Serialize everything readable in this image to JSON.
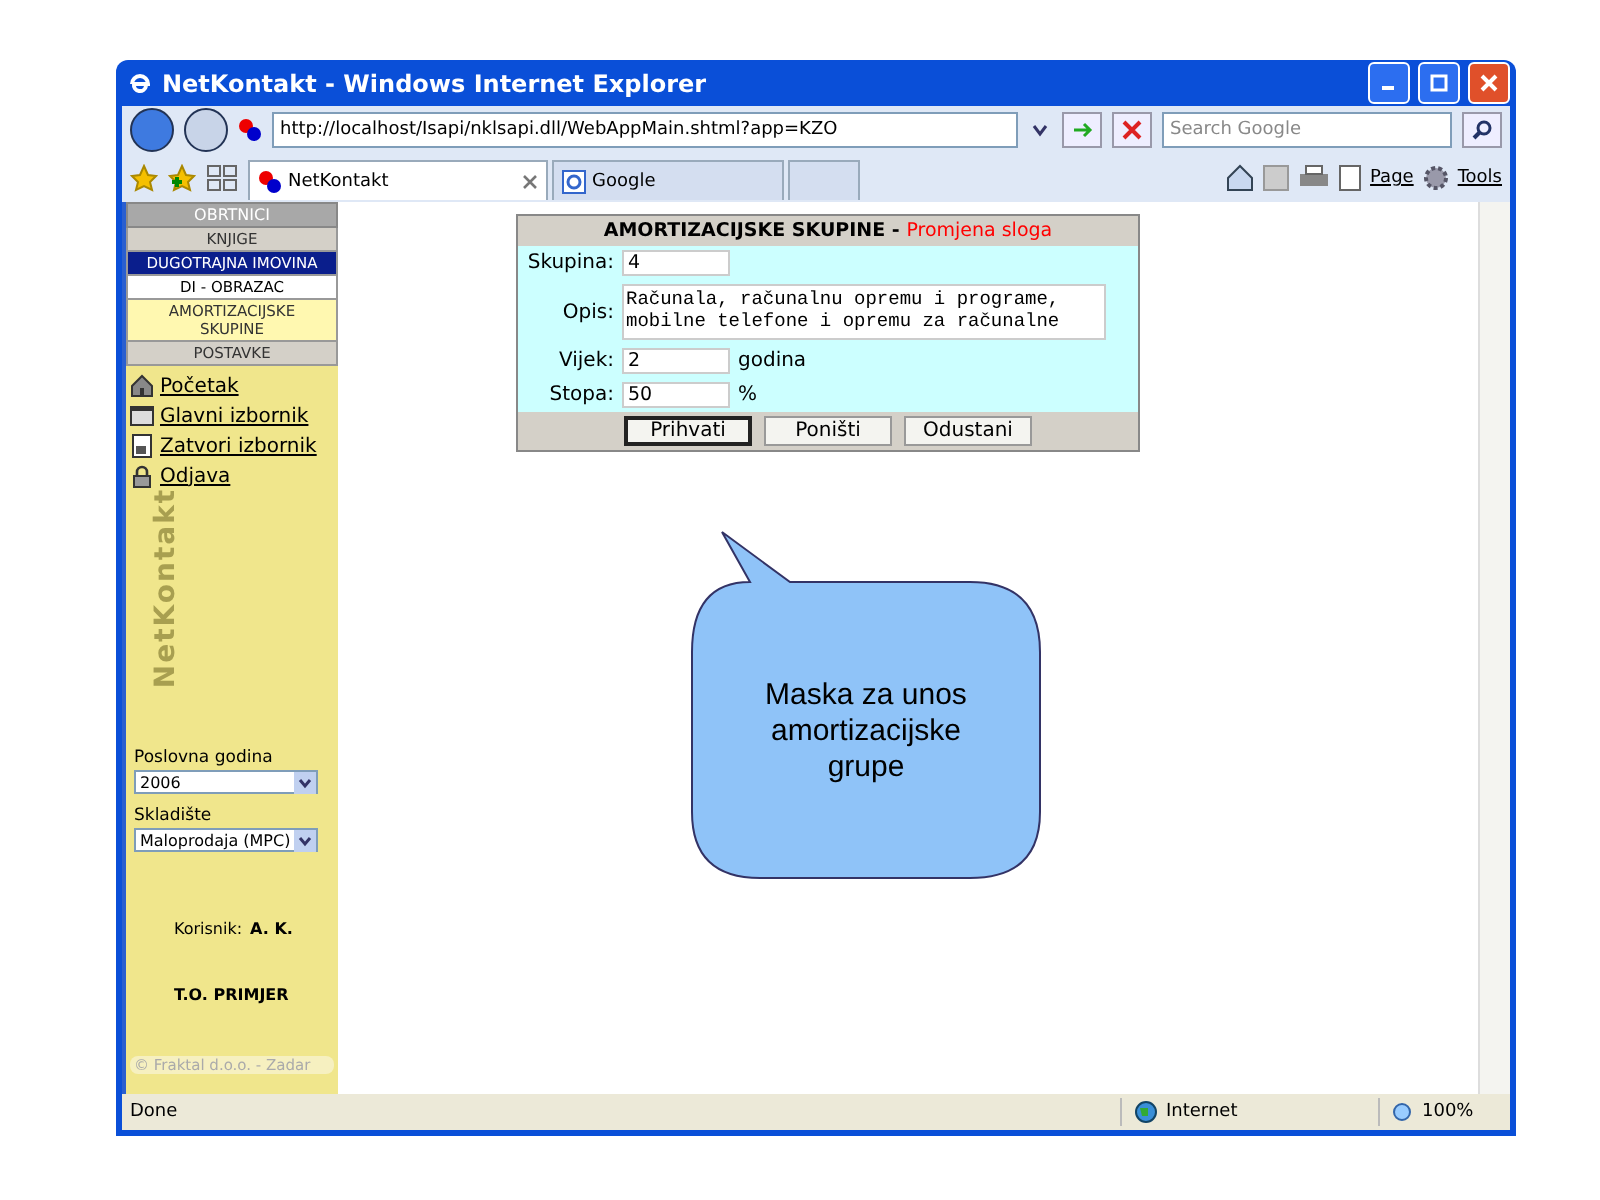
{
  "window": {
    "title": "NetKontakt - Windows Internet Explorer"
  },
  "address_bar": {
    "url": "http://localhost/Isapi/nklsapi.dll/WebAppMain.shtml?app=KZO"
  },
  "search": {
    "placeholder": "Search Google"
  },
  "tabs": [
    {
      "label": "NetKontakt",
      "selected": true
    },
    {
      "label": "Google",
      "selected": false
    }
  ],
  "command_bar": [
    "Page",
    "Tools"
  ],
  "sidebar": {
    "header": "OBRTNICI",
    "menu": [
      {
        "label": "KNJIGE",
        "kind": "section",
        "selected": false
      },
      {
        "label": "DUGOTRAJNA IMOVINA",
        "kind": "group",
        "selected": false
      },
      {
        "label": "DI - OBRAZAC",
        "kind": "item",
        "selected": false
      },
      {
        "label": "AMORTIZACIJSKE SKUPINE",
        "kind": "item",
        "selected": true
      },
      {
        "label": "POSTAVKE",
        "kind": "section",
        "selected": false
      }
    ],
    "links": [
      {
        "label": "Početak",
        "kind": "home"
      },
      {
        "label": "Glavni izbornik",
        "kind": "menu"
      },
      {
        "label": "Zatvori izbornik",
        "kind": "close"
      },
      {
        "label": "Odjava",
        "kind": "lock"
      }
    ],
    "brand": "NetKontakt",
    "selects": [
      {
        "label": "Poslovna godina",
        "value": "2006"
      },
      {
        "label": "Skladište",
        "value": "Maloprodaja (MPC)"
      }
    ],
    "user_label": "Korisnik:",
    "user_value": "A. K.",
    "company": "T.O. PRIMJER",
    "footer": "© Fraktal d.o.o. - Zadar"
  },
  "form": {
    "title": "AMORTIZACIJSKE SKUPINE",
    "separator": " - ",
    "subtitle": "Promjena sloga",
    "fields": [
      {
        "label": "Skupina:",
        "value": "4",
        "kind": "text"
      },
      {
        "label": "Opis:",
        "value": "Računala, računalnu opremu i programe, mobilne telefone i opremu za računalne",
        "kind": "textarea"
      },
      {
        "label": "Vijek:",
        "value": "2",
        "kind": "text",
        "unit": "godina"
      },
      {
        "label": "Stopa:",
        "value": "50",
        "kind": "text",
        "unit": "%"
      }
    ],
    "buttons": [
      {
        "label": "Prihvati",
        "default": true
      },
      {
        "label": "Poništi",
        "default": false
      },
      {
        "label": "Odustani",
        "default": false
      }
    ]
  },
  "callout": {
    "text": "Maska za unos amortizacijske grupe"
  },
  "status_bar": {
    "text": "Done",
    "zone": "Internet",
    "zoom": "100%"
  }
}
